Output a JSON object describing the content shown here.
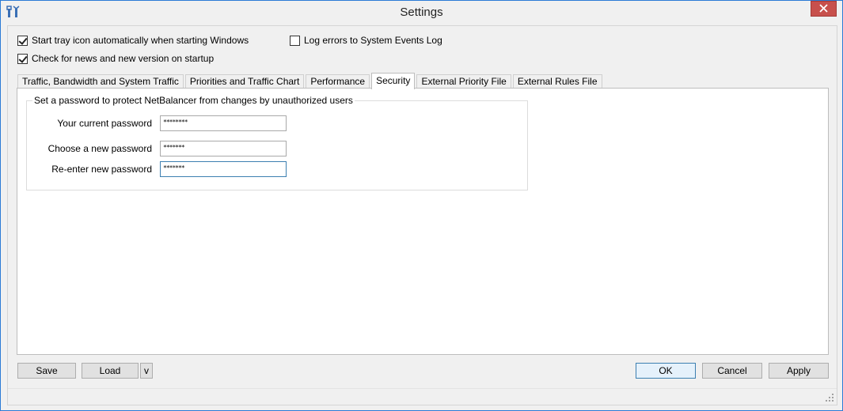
{
  "window": {
    "title": "Settings",
    "icon": "tools-icon",
    "close_icon": "close-icon"
  },
  "options": {
    "start_tray": {
      "label": "Start tray icon automatically when starting Windows",
      "checked": true
    },
    "log_errors": {
      "label": "Log errors to System Events Log",
      "checked": false
    },
    "check_news": {
      "label": "Check for news and new version on startup",
      "checked": true
    }
  },
  "tabs": [
    {
      "label": "Traffic, Bandwidth and System Traffic",
      "active": false
    },
    {
      "label": "Priorities and Traffic Chart",
      "active": false
    },
    {
      "label": "Performance",
      "active": false
    },
    {
      "label": "Security",
      "active": true
    },
    {
      "label": "External Priority File",
      "active": false
    },
    {
      "label": "External Rules File",
      "active": false
    }
  ],
  "security": {
    "group_title": "Set a password to protect NetBalancer from changes by unauthorized users",
    "current_password": {
      "label": "Your current password",
      "value": "********"
    },
    "new_password": {
      "label": "Choose a new password",
      "value": "*******"
    },
    "reenter_password": {
      "label": "Re-enter new password",
      "value": "*******"
    }
  },
  "buttons": {
    "save": "Save",
    "load": "Load",
    "load_menu": "v",
    "ok": "OK",
    "cancel": "Cancel",
    "apply": "Apply"
  },
  "colors": {
    "window_border": "#2b7bd6",
    "close_button": "#c7504c",
    "focus_border": "#3c7fb1"
  }
}
